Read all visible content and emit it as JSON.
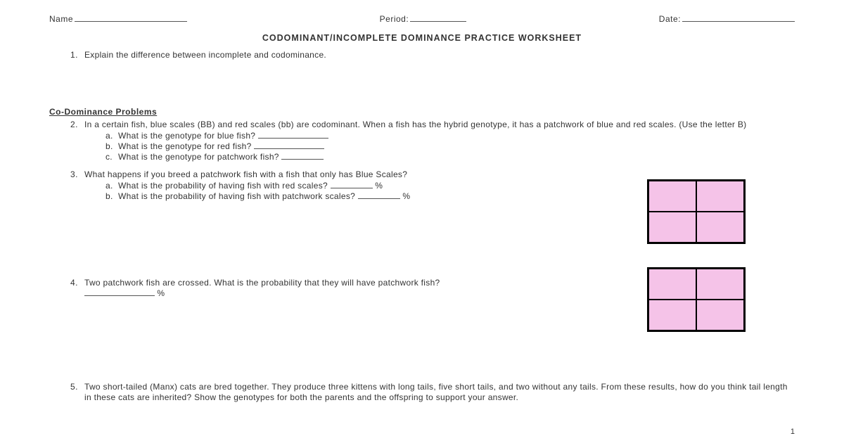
{
  "header": {
    "name_label": "Name",
    "period_label": "Period:",
    "date_label": "Date:"
  },
  "title": "CODOMINANT/INCOMPLETE DOMINANCE PRACTICE WORKSHEET",
  "q1": {
    "num": "1.",
    "text": "Explain the difference between incomplete and codominance."
  },
  "section_codom": "Co-Dominance Problems",
  "q2": {
    "num": "2.",
    "text": "In a certain fish, blue scales (BB) and red scales (bb) are codominant. When a fish has the hybrid genotype, it has a patchwork of blue and red scales. (Use the letter B)",
    "a_letter": "a.",
    "a_text": "What is the genotype for blue fish?",
    "b_letter": "b.",
    "b_text": "What is the genotype for red fish?",
    "c_letter": "c.",
    "c_text": "What is the genotype for patchwork fish?"
  },
  "q3": {
    "num": "3.",
    "text": "What happens if you breed a patchwork fish with a fish that only has Blue Scales?",
    "a_letter": "a.",
    "a_text": "What is the probability of having fish with red scales?",
    "a_pct": "%",
    "b_letter": "b.",
    "b_text": "What is the probability of having fish with patchwork scales?",
    "b_pct": "%"
  },
  "q4": {
    "num": "4.",
    "text": "Two patchwork fish are crossed.  What is the probability that they will have patchwork fish?",
    "pct": "%"
  },
  "q5": {
    "num": "5.",
    "text": "Two short-tailed (Manx) cats are bred together. They produce three kittens with long tails, five short tails, and two without any tails. From these results, how do you think tail length in these cats are inherited? Show the genotypes for both the parents and the offspring to support your answer."
  },
  "page_number": "1"
}
